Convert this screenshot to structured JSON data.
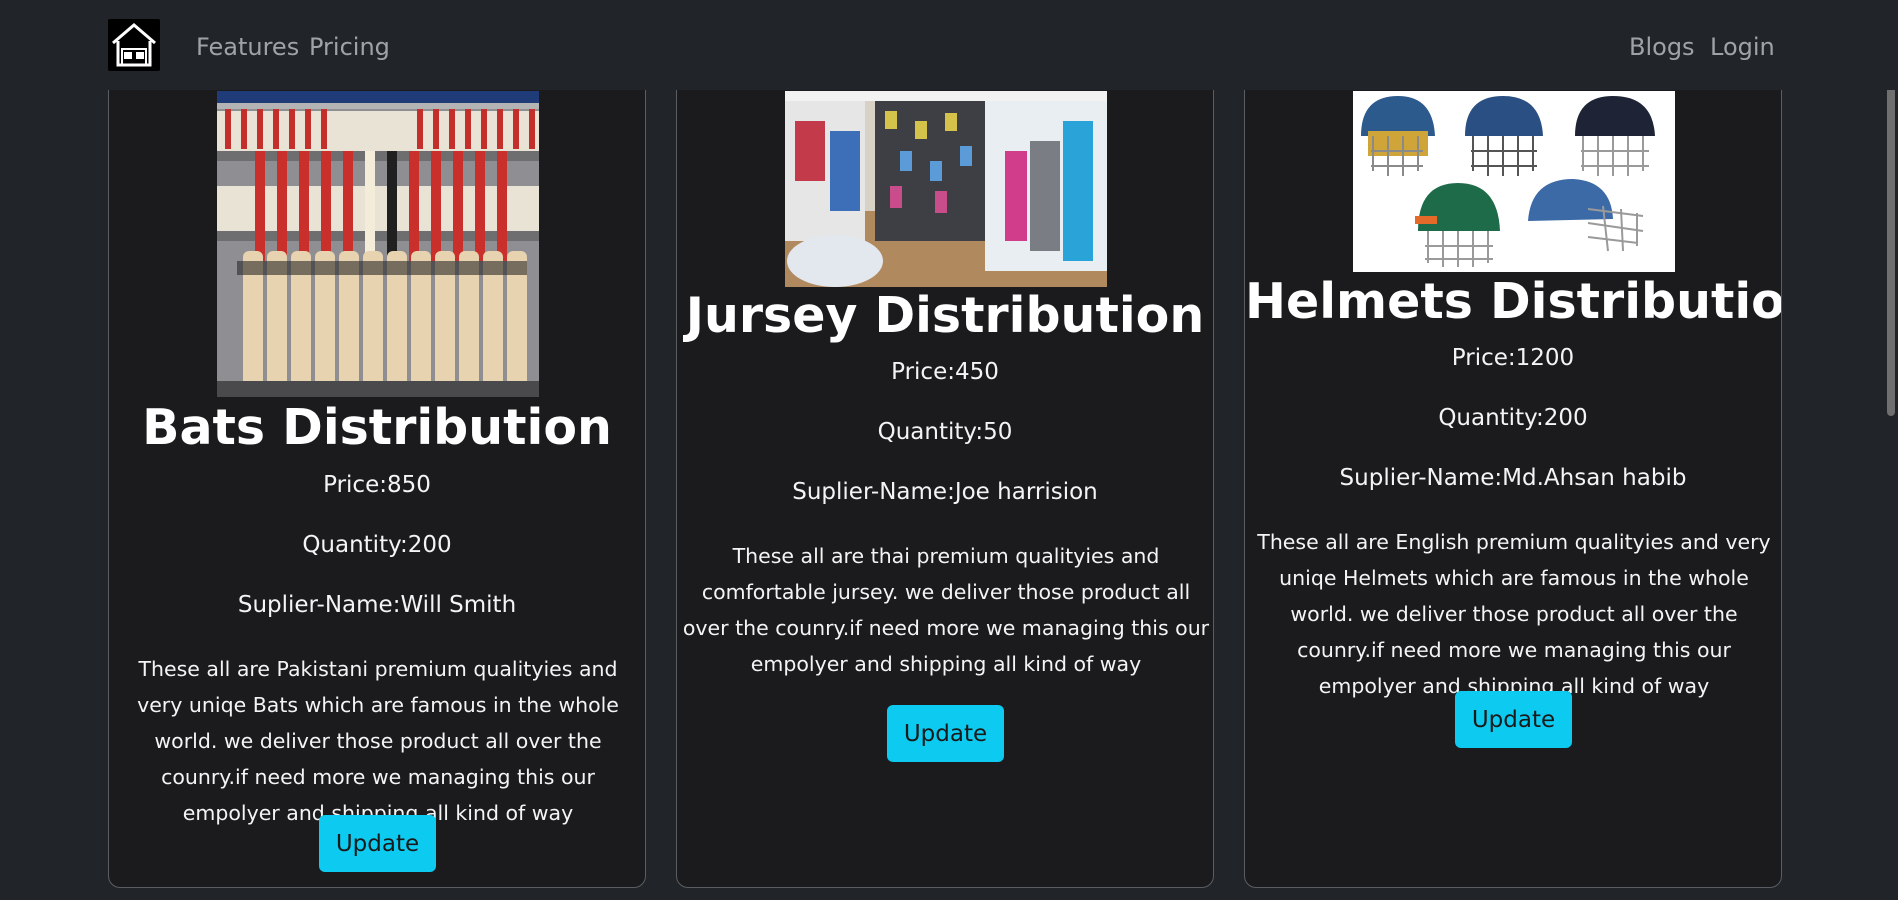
{
  "nav": {
    "features": "Features",
    "pricing": "Pricing",
    "blogs": "Blogs",
    "login": "Login"
  },
  "cards": [
    {
      "title": "Bats Distribution",
      "price": "Price:850",
      "quantity": "Quantity:200",
      "supplier": "Suplier-Name:Will Smith",
      "description": "These all are Pakistani premium qualityies and very uniqe Bats which are famous in the whole world. we deliver those product all over the counry.if need more we managing this our empolyer and shipping all kind of way",
      "button": "Update"
    },
    {
      "title": "Jursey Distribution",
      "price": "Price:450",
      "quantity": "Quantity:50",
      "supplier": "Suplier-Name:Joe harrision",
      "description": "These all are thai premium qualityies and comfortable jursey. we deliver those product all over the counry.if need more we managing this our empolyer and shipping all kind of way",
      "button": "Update"
    },
    {
      "title": "Helmets Distribution",
      "price": "Price:1200",
      "quantity": "Quantity:200",
      "supplier": "Suplier-Name:Md.Ahsan habib",
      "description": "These all are English premium qualityies and very uniqe Helmets which are famous in the whole world. we deliver those product all over the counry.if need more we managing this our empolyer and shipping all kind of way",
      "button": "Update"
    }
  ],
  "colors": {
    "background": "#212529",
    "card_background": "#1b1b1d",
    "button": "#0dcaf0",
    "nav_link": "#9ea3a8"
  },
  "icons": {
    "logo": "warehouse-icon"
  }
}
